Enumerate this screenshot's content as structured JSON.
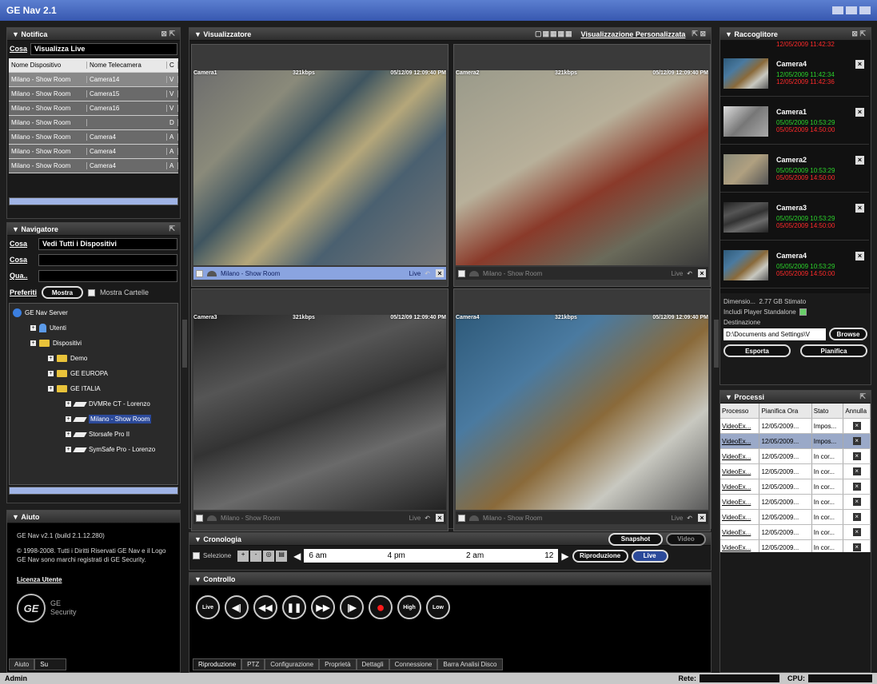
{
  "window": {
    "title": "GE Nav 2.1"
  },
  "notifica": {
    "title": "Notifica",
    "filter_label": "Cosa",
    "filter_value": "Visualizza Live",
    "columns": [
      "Nome Dispositivo",
      "Nome Telecamera",
      "C"
    ],
    "rows": [
      [
        "Milano - Show Room",
        "Camera14",
        "V"
      ],
      [
        "Milano - Show Room",
        "Camera15",
        "V"
      ],
      [
        "Milano - Show Room",
        "Camera16",
        "V"
      ],
      [
        "Milano - Show Room",
        "",
        "D"
      ],
      [
        "Milano - Show Room",
        "Camera4",
        "A"
      ],
      [
        "Milano - Show Room",
        "Camera4",
        "A"
      ],
      [
        "Milano - Show Room",
        "Camera4",
        "A"
      ]
    ]
  },
  "navigatore": {
    "title": "Navigatore",
    "cosa_label": "Cosa",
    "cosa_value": "Vedi Tutti i Dispositivi",
    "cosa2_label": "Cosa",
    "quando_label": "Qua..",
    "preferiti_label": "Preferiti",
    "mostra_button": "Mostra",
    "mostra_cartelle": "Mostra Cartelle",
    "tree": [
      {
        "label": "GE Nav Server",
        "level": 0,
        "icon": "server-icon"
      },
      {
        "label": "Utenti",
        "level": 1,
        "icon": "user-icon"
      },
      {
        "label": "Dispositivi",
        "level": 1,
        "icon": "folder-icon"
      },
      {
        "label": "Demo",
        "level": 2,
        "icon": "folder-icon"
      },
      {
        "label": "GE EUROPA",
        "level": 2,
        "icon": "folder-icon"
      },
      {
        "label": "GE ITALIA",
        "level": 2,
        "icon": "folder-icon"
      },
      {
        "label": "DVMRe CT - Lorenzo",
        "level": 3,
        "icon": "dvr-icon"
      },
      {
        "label": "Milano - Show Room",
        "level": 3,
        "icon": "dvr-icon",
        "selected": true
      },
      {
        "label": "Storsafe Pro II",
        "level": 3,
        "icon": "dvr-icon"
      },
      {
        "label": "SymSafe Pro - Lorenzo",
        "level": 3,
        "icon": "dvr-icon"
      }
    ]
  },
  "aiuto": {
    "title": "Aiuto",
    "version": "GE Nav v2.1 (build 2.1.12.280)",
    "copyright": "© 1998-2008. Tutti i Diritti Riservati GE Nav e il Logo GE Nav sono marchi registrati di GE Security.",
    "license": "Licenza Utente",
    "logo_text": "GE",
    "logo_sub1": "GE",
    "logo_sub2": "Security",
    "tab_aiuto": "Aiuto",
    "tab_su": "Su"
  },
  "visualizzatore": {
    "title": "Visualizzatore",
    "custom_view": "Visualizzazione Personalizzata",
    "cameras": [
      {
        "name": "Camera1",
        "rate": "321kbps",
        "time": "05/12/09 12:09:40 PM",
        "device": "Milano - Show Room",
        "status": "Live",
        "active": true
      },
      {
        "name": "Camera2",
        "rate": "321kbps",
        "time": "05/12/09 12:09:40 PM",
        "device": "Milano - Show Room",
        "status": "Live",
        "active": false
      },
      {
        "name": "Camera3",
        "rate": "321kbps",
        "time": "05/12/09 12:09:40 PM",
        "device": "Milano - Show Room",
        "status": "Live",
        "active": false
      },
      {
        "name": "Camera4",
        "rate": "321kbps",
        "time": "05/12/09 12:09:40 PM",
        "device": "Milano - Show Room",
        "status": "Live",
        "active": false
      }
    ]
  },
  "cronologia": {
    "title": "Cronologia",
    "selezione": "Selezione",
    "snapshot": "Snapshot",
    "video": "Video",
    "timeline": [
      "6 am",
      "4 pm",
      "2 am",
      "12"
    ],
    "riproduzione": "Riproduzione",
    "live": "Live"
  },
  "controllo": {
    "title": "Controllo",
    "buttons": [
      "Live",
      "◀|",
      "◀◀",
      "❚❚",
      "▶▶",
      "|▶",
      "●",
      "High",
      "Low"
    ],
    "tabs": [
      "Riproduzione",
      "PTZ",
      "Configurazione",
      "Proprietà",
      "Dettagli",
      "Connessione",
      "Barra Analisi Disco"
    ]
  },
  "raccoglitore": {
    "title": "Raccoglitore",
    "top_date": "12/05/2009 11:42:32",
    "items": [
      {
        "name": "Camera4",
        "d1": "12/05/2009 11:42:34",
        "d2": "12/05/2009 11:42:36"
      },
      {
        "name": "Camera1",
        "d1": "05/05/2009 10:53:29",
        "d2": "05/05/2009 14:50:00"
      },
      {
        "name": "Camera2",
        "d1": "05/05/2009 10:53:29",
        "d2": "05/05/2009 14:50:00"
      },
      {
        "name": "Camera3",
        "d1": "05/05/2009 10:53:29",
        "d2": "05/05/2009 14:50:00"
      },
      {
        "name": "Camera4",
        "d1": "05/05/2009 10:53:29",
        "d2": "05/05/2009 14:50:00"
      }
    ],
    "dimensione_label": "Dimensio...",
    "dimensione_value": "2.77 GB Stimato",
    "include_player": "Includi Player Standalone",
    "destinazione_label": "Destinazione",
    "destinazione_value": "D:\\Documents and Settings\\V",
    "browse": "Browse",
    "esporta": "Esporta",
    "pianifica": "Pianifica"
  },
  "processi": {
    "title": "Processi",
    "columns": [
      "Processo",
      "Pianifica Ora",
      "Stato",
      "Annulla"
    ],
    "rows": [
      [
        "VideoEx...",
        "12/05/2009...",
        "Impos..."
      ],
      [
        "VideoEx...",
        "12/05/2009...",
        "Impos..."
      ],
      [
        "VideoEx...",
        "12/05/2009...",
        "In cor..."
      ],
      [
        "VideoEx...",
        "12/05/2009...",
        "In cor..."
      ],
      [
        "VideoEx...",
        "12/05/2009...",
        "In cor..."
      ],
      [
        "VideoEx...",
        "12/05/2009...",
        "In cor..."
      ],
      [
        "VideoEx...",
        "12/05/2009...",
        "In cor..."
      ],
      [
        "VideoEx...",
        "12/05/2009...",
        "In cor..."
      ],
      [
        "VideoEx...",
        "12/05/2009...",
        "In cor..."
      ]
    ]
  },
  "statusbar": {
    "user": "Admin",
    "rete_label": "Rete:",
    "cpu_label": "CPU:"
  }
}
